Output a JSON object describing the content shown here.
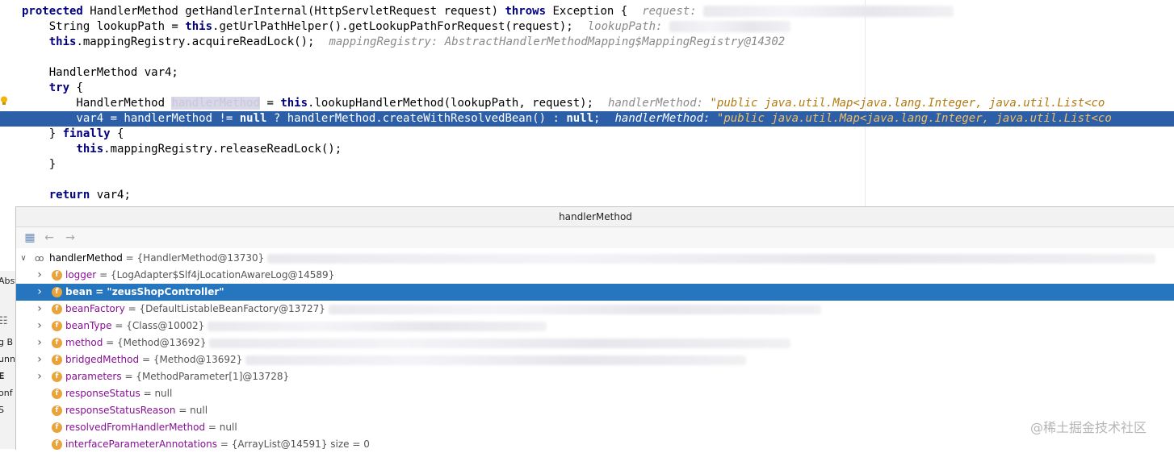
{
  "editor": {
    "line1": {
      "kw1": "protected",
      "t1": " HandlerMethod getHandlerInternal(HttpServletRequest request) ",
      "kw2": "throws",
      "t2": " Exception {",
      "hint": "request:"
    },
    "line2": {
      "t1": "    String lookupPath = ",
      "kw1": "this",
      "t2": ".getUrlPathHelper().getLookupPathForRequest(request);",
      "hint": "lookupPath:"
    },
    "line3": {
      "t1": "    ",
      "kw1": "this",
      "t2": ".mappingRegistry.acquireReadLock();",
      "hint": "mappingRegistry: AbstractHandlerMethodMapping$MappingRegistry@14302"
    },
    "line5": {
      "t1": "    HandlerMethod var4;"
    },
    "line6": {
      "t1": "    ",
      "kw1": "try",
      "t2": " {"
    },
    "line7": {
      "t1": "        HandlerMethod ",
      "sel": "handlerMethod",
      "t2": " = ",
      "kw1": "this",
      "t3": ".lookupHandlerMethod(lookupPath, request);",
      "hint_name": "handlerMethod: ",
      "hint_str": "\"public java.util.Map<java.lang.Integer, java.util.List<co"
    },
    "line8": {
      "t1": "        var4 = handlerMethod != ",
      "kw1": "null",
      "t2": " ? handlerMethod.createWithResolvedBean() : ",
      "kw2": "null",
      "t3": ";",
      "hint_name": "handlerMethod: ",
      "hint_str": "\"public java.util.Map<java.lang.Integer, java.util.List<co"
    },
    "line9": {
      "t1": "    } ",
      "kw1": "finally",
      "t2": " {"
    },
    "line10": {
      "t1": "        ",
      "kw1": "this",
      "t2": ".mappingRegistry.releaseReadLock();"
    },
    "line11": {
      "t1": "    }"
    },
    "line13": {
      "t1": "    ",
      "kw1": "return",
      "t2": " var4;"
    }
  },
  "popup": {
    "title": "handlerMethod",
    "toolbar": {
      "icons": [
        "hierarchy-icon",
        "back-arrow-icon",
        "forward-arrow-icon"
      ]
    },
    "root": {
      "name": "handlerMethod",
      "value": "= {HandlerMethod@13730}"
    },
    "fields": [
      {
        "name": "logger",
        "value": "= {LogAdapter$Slf4jLocationAwareLog@14589}",
        "expandable": true
      },
      {
        "name": "bean",
        "value": "= \"zeusShopController\"",
        "expandable": true,
        "selected": true
      },
      {
        "name": "beanFactory",
        "value": "= {DefaultListableBeanFactory@13727}",
        "expandable": true
      },
      {
        "name": "beanType",
        "value": "= {Class@10002}",
        "expandable": true
      },
      {
        "name": "method",
        "value": "= {Method@13692}",
        "expandable": true
      },
      {
        "name": "bridgedMethod",
        "value": "= {Method@13692}",
        "expandable": true
      },
      {
        "name": "parameters",
        "value": "= {MethodParameter[1]@13728}",
        "expandable": true
      },
      {
        "name": "responseStatus",
        "value": "= null",
        "expandable": false
      },
      {
        "name": "responseStatusReason",
        "value": "= null",
        "expandable": false
      },
      {
        "name": "resolvedFromHandlerMethod",
        "value": "= null",
        "expandable": false
      },
      {
        "name": "interfaceParameterAnnotations",
        "value": "= {ArrayList@14591}  size = 0",
        "expandable": false
      }
    ]
  },
  "left_panel": {
    "fragments": [
      "Abst",
      "g B",
      "unn",
      "E",
      "onf",
      "S"
    ]
  },
  "watermark": "@稀土掘金技术社区",
  "colors": {
    "keyword": "#000080",
    "field_name": "#871094",
    "selection": "#2675bf",
    "exec_line": "#2d5fa8",
    "field_badge": "#e8a33b"
  }
}
